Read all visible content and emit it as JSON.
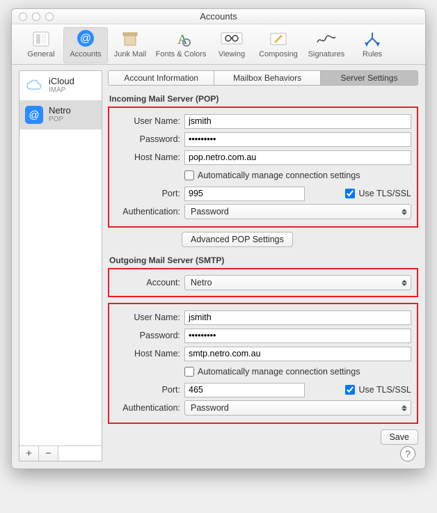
{
  "window": {
    "title": "Accounts"
  },
  "toolbar": {
    "general": "General",
    "accounts": "Accounts",
    "junk": "Junk Mail",
    "fonts": "Fonts & Colors",
    "viewing": "Viewing",
    "composing": "Composing",
    "signatures": "Signatures",
    "rules": "Rules"
  },
  "sidebar": {
    "items": [
      {
        "name": "iCloud",
        "type": "IMAP"
      },
      {
        "name": "Netro",
        "type": "POP"
      }
    ],
    "add": "+",
    "remove": "−"
  },
  "tabs": {
    "info": "Account Information",
    "behaviors": "Mailbox Behaviors",
    "server": "Server Settings"
  },
  "incoming": {
    "title": "Incoming Mail Server (POP)",
    "user_label": "User Name:",
    "user_value": "jsmith",
    "pass_label": "Password:",
    "pass_value": "•••••••••",
    "host_label": "Host Name:",
    "host_value": "pop.netro.com.au",
    "auto_label": "Automatically manage connection settings",
    "auto_checked": false,
    "port_label": "Port:",
    "port_value": "995",
    "tls_label": "Use TLS/SSL",
    "tls_checked": true,
    "auth_label": "Authentication:",
    "auth_value": "Password",
    "advanced": "Advanced POP Settings"
  },
  "outgoing": {
    "title": "Outgoing Mail Server (SMTP)",
    "account_label": "Account:",
    "account_value": "Netro",
    "user_label": "User Name:",
    "user_value": "jsmith",
    "pass_label": "Password:",
    "pass_value": "•••••••••",
    "host_label": "Host Name:",
    "host_value": "smtp.netro.com.au",
    "auto_label": "Automatically manage connection settings",
    "auto_checked": false,
    "port_label": "Port:",
    "port_value": "465",
    "tls_label": "Use TLS/SSL",
    "tls_checked": true,
    "auth_label": "Authentication:",
    "auth_value": "Password"
  },
  "save_label": "Save",
  "help_label": "?"
}
